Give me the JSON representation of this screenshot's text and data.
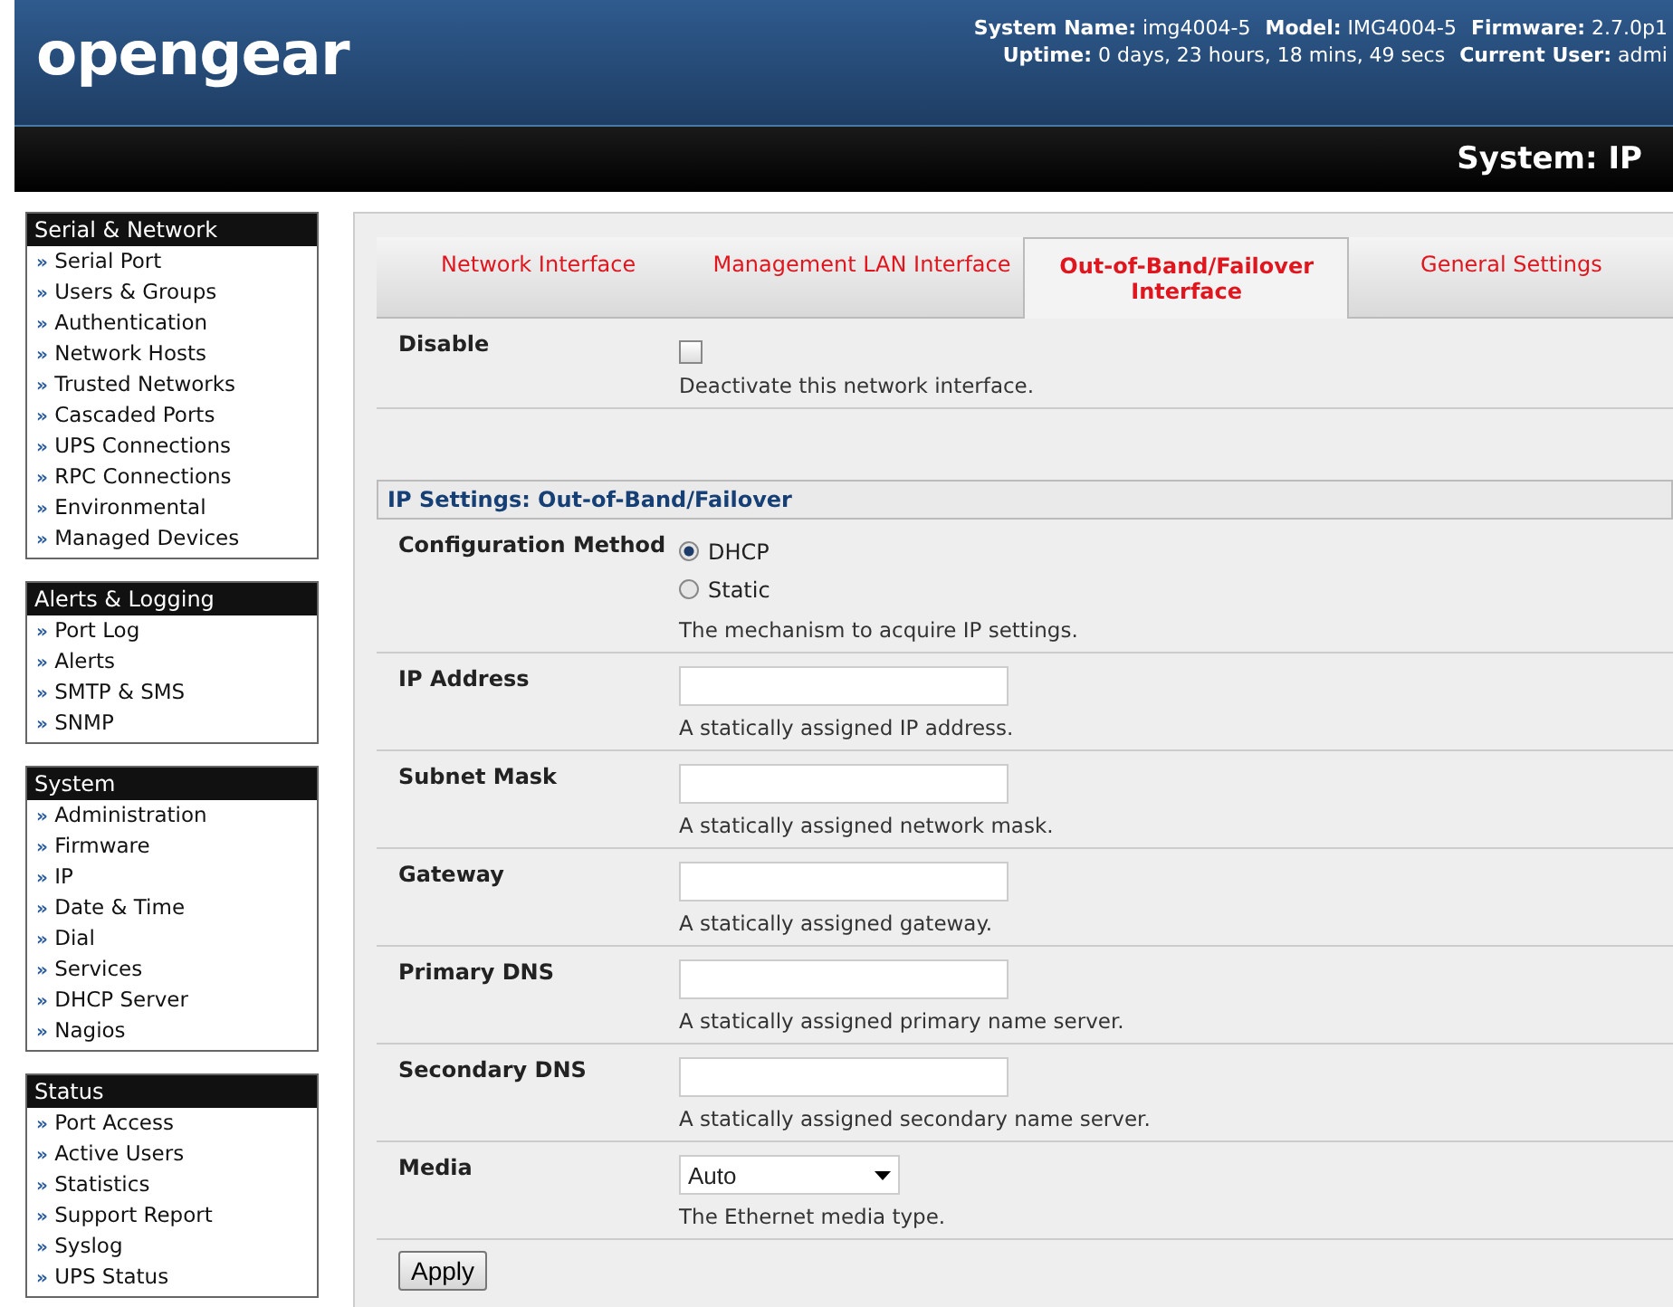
{
  "header": {
    "logo": "opengear",
    "info_lines": [
      [
        {
          "label": "System Name:",
          "value": "img4004-5"
        },
        {
          "label": "Model:",
          "value": "IMG4004-5"
        },
        {
          "label": "Firmware:",
          "value": "2.7.0p1"
        }
      ],
      [
        {
          "label": "Uptime:",
          "value": "0 days, 23 hours, 18 mins, 49 secs"
        },
        {
          "label": "Current User:",
          "value": "admi"
        }
      ]
    ],
    "page_title": "System: IP"
  },
  "sidebar": {
    "bullet": "»",
    "sections": [
      {
        "title": "Serial & Network",
        "items": [
          "Serial Port",
          "Users & Groups",
          "Authentication",
          "Network Hosts",
          "Trusted Networks",
          "Cascaded Ports",
          "UPS Connections",
          "RPC Connections",
          "Environmental",
          "Managed Devices"
        ]
      },
      {
        "title": "Alerts & Logging",
        "items": [
          "Port Log",
          "Alerts",
          "SMTP & SMS",
          "SNMP"
        ]
      },
      {
        "title": "System",
        "items": [
          "Administration",
          "Firmware",
          "IP",
          "Date & Time",
          "Dial",
          "Services",
          "DHCP Server",
          "Nagios"
        ]
      },
      {
        "title": "Status",
        "items": [
          "Port Access",
          "Active Users",
          "Statistics",
          "Support Report",
          "Syslog",
          "UPS Status"
        ]
      }
    ]
  },
  "tabs": [
    {
      "label": "Network Interface",
      "selected": false
    },
    {
      "label": "Management LAN Interface",
      "selected": false
    },
    {
      "label": "Out-of-Band/Failover Interface",
      "selected": true
    },
    {
      "label": "General Settings",
      "selected": false
    }
  ],
  "disable": {
    "label": "Disable",
    "checked": false,
    "hint": "Deactivate this network interface."
  },
  "section_title": "IP Settings: Out-of-Band/Failover",
  "config": {
    "label": "Configuration Method",
    "options": [
      {
        "label": "DHCP",
        "selected": true
      },
      {
        "label": "Static",
        "selected": false
      }
    ],
    "hint": "The mechanism to acquire IP settings."
  },
  "fields": [
    {
      "kind": "text",
      "label": "IP Address",
      "hint": "A statically assigned IP address."
    },
    {
      "kind": "text",
      "label": "Subnet Mask",
      "hint": "A statically assigned network mask."
    },
    {
      "kind": "text",
      "label": "Gateway",
      "hint": "A statically assigned gateway."
    },
    {
      "kind": "text",
      "label": "Primary DNS",
      "hint": "A statically assigned primary name server."
    },
    {
      "kind": "text",
      "label": "Secondary DNS",
      "hint": "A statically assigned secondary name server."
    },
    {
      "kind": "select",
      "label": "Media",
      "value": "Auto",
      "hint": "The Ethernet media type."
    }
  ],
  "apply": "Apply"
}
